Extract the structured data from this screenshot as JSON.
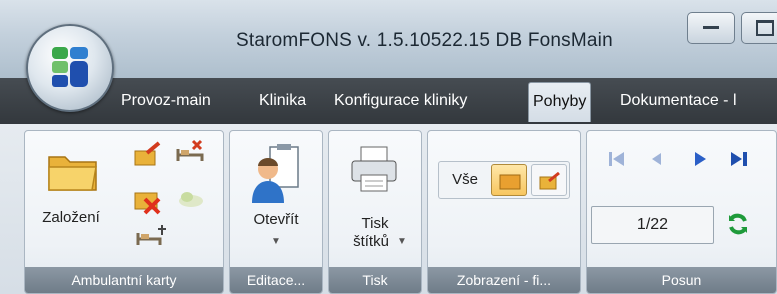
{
  "window": {
    "title": "StaromFONS v. 1.5.10522.15  DB FonsMain",
    "minimize_label": "",
    "maximize_label": ""
  },
  "tabs": [
    {
      "label": "Provoz-main"
    },
    {
      "label": "Klinika"
    },
    {
      "label": "Konfigurace kliniky"
    },
    {
      "label": "Pohyby",
      "active": true
    },
    {
      "label": "Dokumentace - l"
    }
  ],
  "groups": {
    "ambulantni": {
      "label": "Ambulantní karty",
      "zalozeni_label": "Založení"
    },
    "editace": {
      "label": "Editace...",
      "otevrit_label": "Otevřít"
    },
    "tisk": {
      "label": "Tisk",
      "tisk_stitku_line1": "Tisk",
      "tisk_stitku_line2": "štítků"
    },
    "zobrazeni": {
      "label": "Zobrazení - fi...",
      "vse_label": "Vše"
    },
    "posun": {
      "label": "Posun",
      "page_value": "1/22"
    }
  },
  "colors": {
    "tabstrip": "#3b4147",
    "active_tab": "#dde4eb",
    "group_label_bg": "#7d8995",
    "nav_blue": "#2b5fc7",
    "refresh_green": "#1e9a3a"
  }
}
